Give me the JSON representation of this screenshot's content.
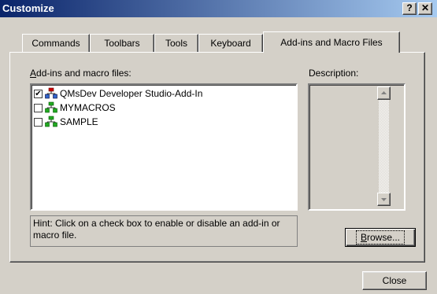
{
  "window": {
    "title": "Customize",
    "help_label": "?",
    "close_label": "✕"
  },
  "tabs": [
    {
      "label": "Commands"
    },
    {
      "label": "Toolbars"
    },
    {
      "label": "Tools"
    },
    {
      "label": "Keyboard"
    },
    {
      "label": "Add-ins and Macro Files",
      "active": true
    }
  ],
  "addins": {
    "label_prefix": "A",
    "label_rest": "dd-ins and macro files:",
    "items": [
      {
        "label": "QMsDev Developer Studio-Add-In",
        "checked": true,
        "icon": "addin-icon"
      },
      {
        "label": "MYMACROS",
        "checked": false,
        "icon": "macro-icon"
      },
      {
        "label": "SAMPLE",
        "checked": false,
        "icon": "macro-icon"
      }
    ]
  },
  "description": {
    "label": "Description:"
  },
  "hint": {
    "text": "Hint: Click on a check box to enable or disable an add-in or macro file."
  },
  "buttons": {
    "browse_prefix": "B",
    "browse_rest": "rowse...",
    "close": "Close"
  },
  "colors": {
    "title_start": "#0a246a",
    "title_end": "#a6caf0",
    "face": "#d4d0c8"
  }
}
